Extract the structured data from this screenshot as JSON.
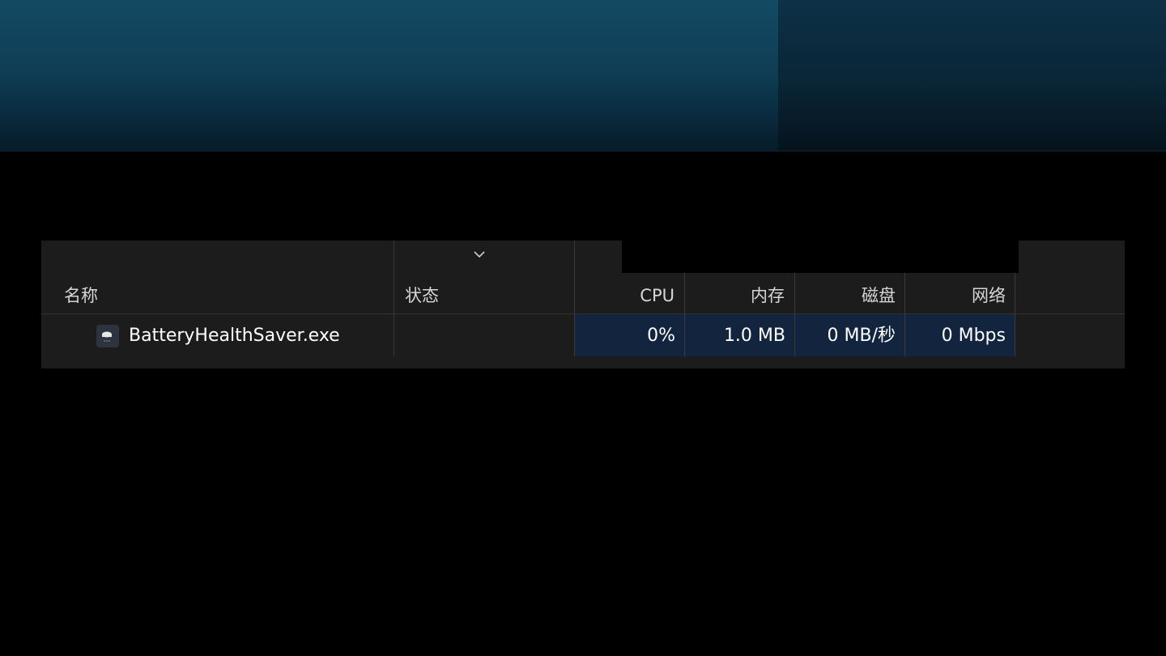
{
  "table": {
    "columns": {
      "name": "名称",
      "status": "状态",
      "cpu": "CPU",
      "memory": "内存",
      "disk": "磁盘",
      "network": "网络"
    },
    "sort_icon": "chevron-down-icon",
    "rows": [
      {
        "name": "BatteryHealthSaver.exe",
        "status": "",
        "cpu": "0%",
        "memory": "1.0 MB",
        "disk": "0 MB/秒",
        "network": "0 Mbps",
        "icon": "battery-app-icon"
      }
    ]
  },
  "colors": {
    "table_background": "#1c1c1c",
    "metric_highlight": "#13243f",
    "banner": "#134a63"
  }
}
